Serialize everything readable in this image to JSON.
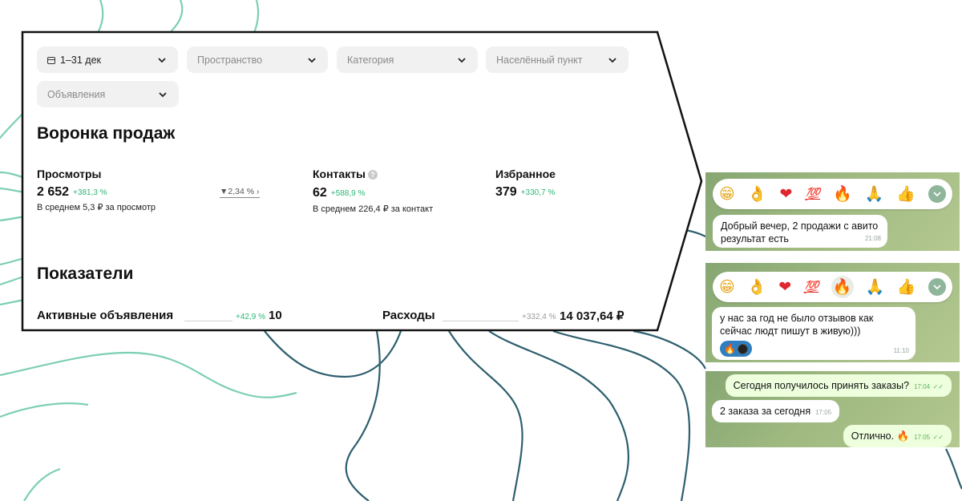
{
  "filters": {
    "date": "1–31 дек",
    "space": "Пространство",
    "category": "Категория",
    "city": "Населённый пункт",
    "ads": "Объявления"
  },
  "funnel": {
    "title": "Воронка продаж",
    "views": {
      "label": "Просмотры",
      "value": "2 652",
      "delta": "+381,3 %",
      "sub": "В среднем 5,3 ₽ за просмотр"
    },
    "conversion": "2,34 %",
    "contacts": {
      "label": "Контакты",
      "help": "?",
      "value": "62",
      "delta": "+588,9 %",
      "sub": "В среднем 226,4 ₽ за контакт"
    },
    "favorites": {
      "label": "Избранное",
      "value": "379",
      "delta": "+330,7 %"
    }
  },
  "indicators": {
    "title": "Показатели",
    "active_ads": {
      "label": "Активные объявления",
      "delta": "+42,9 %",
      "value": "10"
    },
    "expenses": {
      "label": "Расходы",
      "delta": "+332,4 %",
      "value": "14 037,64 ₽"
    }
  },
  "chat1": {
    "reactions": [
      "😁",
      "👌",
      "❤",
      "💯",
      "🔥",
      "🙏",
      "👍"
    ],
    "message": {
      "text": "Добрый вечер, 2 продажи с авито результат есть",
      "time": "21:08"
    }
  },
  "chat2": {
    "reactions": [
      "😁",
      "👌",
      "❤",
      "💯",
      "🔥",
      "🙏",
      "👍"
    ],
    "message": {
      "text": "у нас за год не было отзывов как сейчас людт пишут в живую)))",
      "time": "11:10",
      "reaction": "🔥"
    }
  },
  "chat3": {
    "messages": [
      {
        "text": "Сегодня получилось принять заказы?",
        "time": "17:04",
        "dir": "out"
      },
      {
        "text": "2  заказа за сегодня",
        "time": "17:05",
        "dir": "in"
      },
      {
        "text": "Отлично. 🔥",
        "time": "17:05",
        "dir": "out"
      }
    ]
  },
  "colors": {
    "accent_green": "#2cb673",
    "line_teal": "#2e5f6e",
    "line_mint": "#7ccfb3",
    "chat_green": "#9fb981"
  }
}
